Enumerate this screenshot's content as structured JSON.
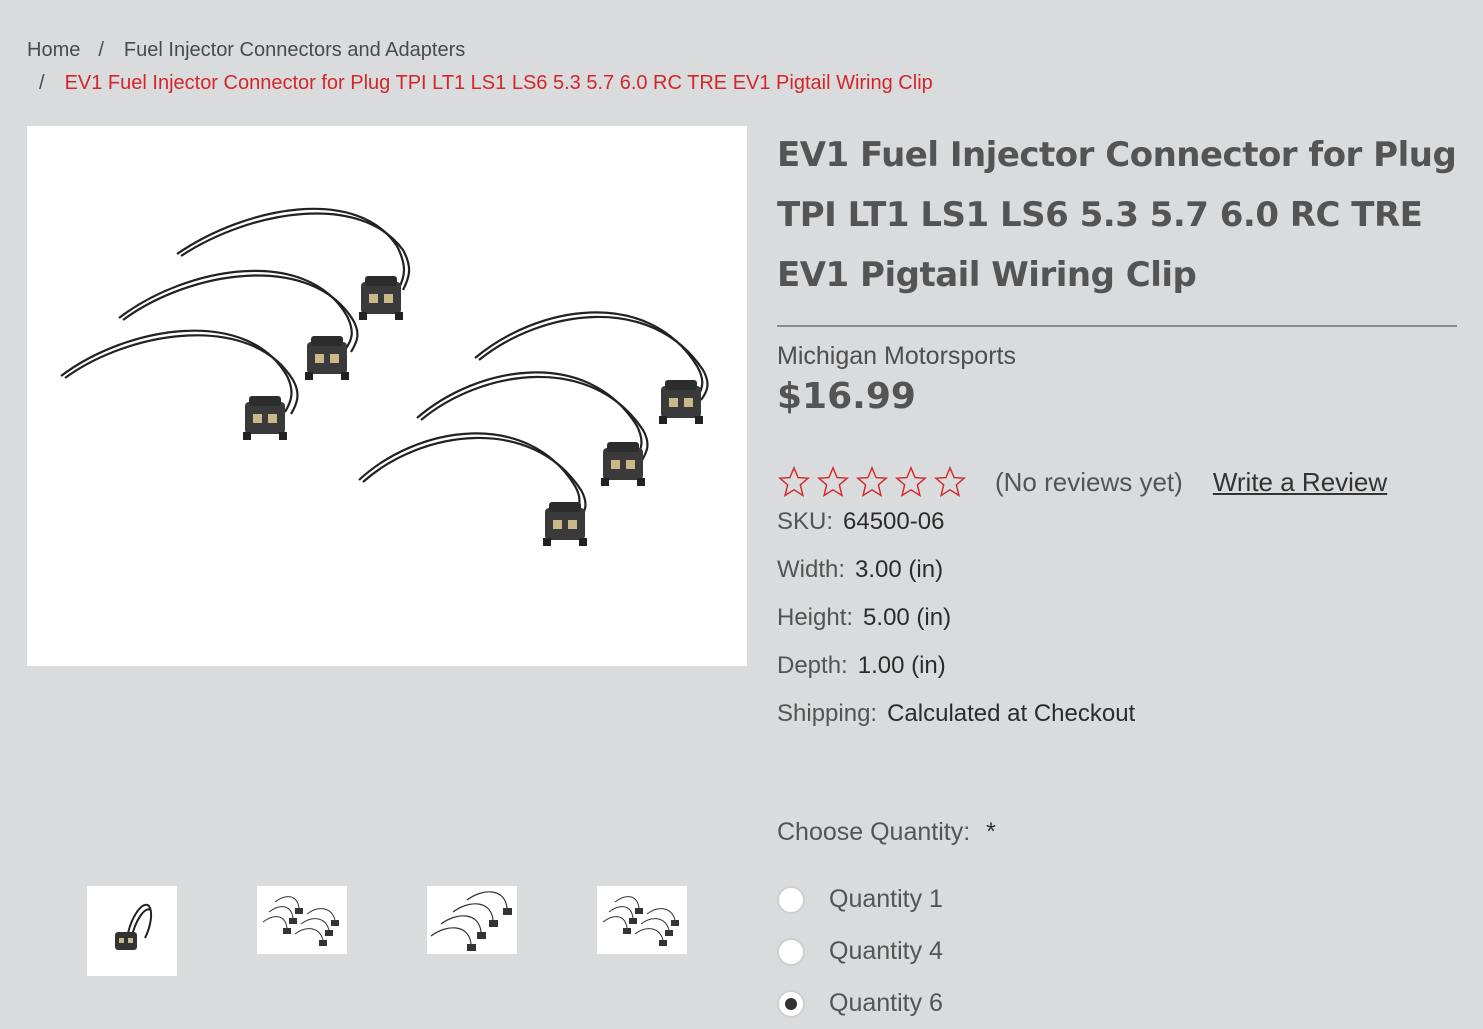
{
  "breadcrumb": {
    "items": [
      "Home",
      "Fuel Injector Connectors and Adapters",
      "EV1 Fuel Injector Connector for Plug TPI LT1 LS1 LS6 5.3 5.7 6.0 RC TRE EV1 Pigtail Wiring Clip"
    ],
    "separator": "/"
  },
  "product": {
    "title": "EV1 Fuel Injector Connector for Plug TPI LT1 LS1 LS6 5.3 5.7 6.0 RC TRE EV1 Pigtail Wiring Clip",
    "brand": "Michigan Motorsports",
    "price": "$16.99",
    "rating": {
      "stars_filled": 0,
      "stars_total": 5,
      "review_text": "(No reviews yet)",
      "write_review": "Write a Review"
    },
    "specs": [
      {
        "label": "SKU:",
        "value": "64500-06"
      },
      {
        "label": "Width:",
        "value": "3.00 (in)"
      },
      {
        "label": "Height:",
        "value": "5.00 (in)"
      },
      {
        "label": "Depth:",
        "value": "1.00 (in)"
      },
      {
        "label": "Shipping:",
        "value": "Calculated at Checkout"
      }
    ]
  },
  "quantity": {
    "label": "Choose Quantity:",
    "required_mark": "*",
    "options": [
      "Quantity 1",
      "Quantity 4",
      "Quantity 6"
    ],
    "selected": "Quantity 6"
  },
  "colors": {
    "accent_red": "#d3262a",
    "background": "#dadbdc",
    "text": "#545454"
  }
}
